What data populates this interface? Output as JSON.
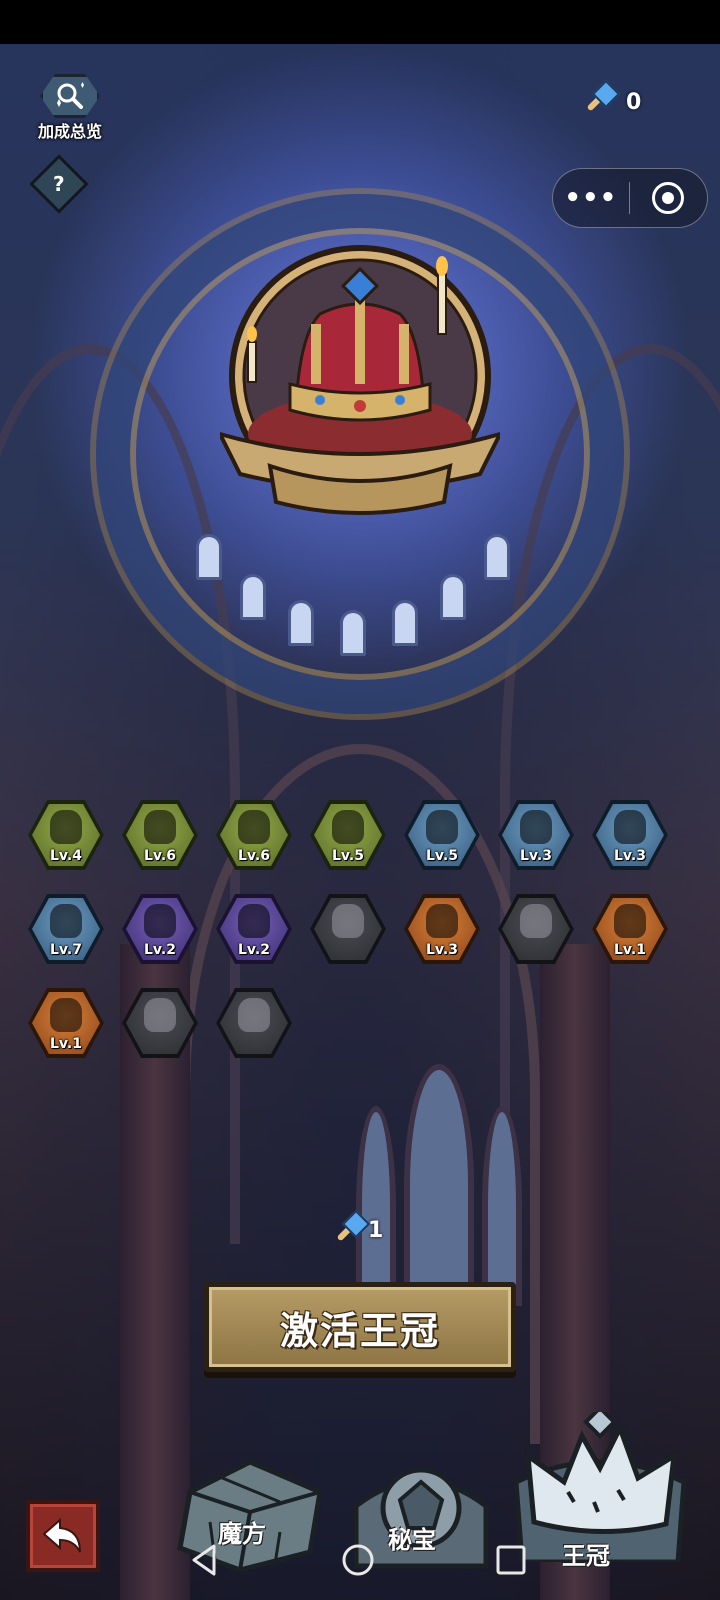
{
  "header": {
    "bonus_overview_label": "加成总览",
    "help_label": "?",
    "currency_value": "0",
    "capsule_more": "•••"
  },
  "relics": [
    {
      "id": "relic-1",
      "tier": "green",
      "level": "Lv.4"
    },
    {
      "id": "relic-2",
      "tier": "green",
      "level": "Lv.6"
    },
    {
      "id": "relic-3",
      "tier": "green",
      "level": "Lv.6"
    },
    {
      "id": "relic-4",
      "tier": "green",
      "level": "Lv.5"
    },
    {
      "id": "relic-5",
      "tier": "blue",
      "level": "Lv.5"
    },
    {
      "id": "relic-6",
      "tier": "blue",
      "level": "Lv.3"
    },
    {
      "id": "relic-7",
      "tier": "blue",
      "level": "Lv.3"
    },
    {
      "id": "relic-8",
      "tier": "blue",
      "level": "Lv.7"
    },
    {
      "id": "relic-9",
      "tier": "purple",
      "level": "Lv.2"
    },
    {
      "id": "relic-10",
      "tier": "purple",
      "level": "Lv.2"
    },
    {
      "id": "relic-11",
      "tier": "gray",
      "level": ""
    },
    {
      "id": "relic-12",
      "tier": "orange",
      "level": "Lv.3"
    },
    {
      "id": "relic-13",
      "tier": "gray",
      "level": ""
    },
    {
      "id": "relic-14",
      "tier": "orange",
      "level": "Lv.1"
    },
    {
      "id": "relic-15",
      "tier": "orange",
      "level": "Lv.1"
    },
    {
      "id": "relic-16",
      "tier": "gray",
      "level": ""
    },
    {
      "id": "relic-17",
      "tier": "gray",
      "level": ""
    }
  ],
  "activation": {
    "cost_value": "1",
    "button_label": "激活王冠"
  },
  "bottom_nav": {
    "tabs": [
      {
        "label": "魔方"
      },
      {
        "label": "秘宝"
      },
      {
        "label": "王冠"
      }
    ]
  },
  "colors": {
    "activate_button": "#a58a55",
    "back_button": "#8a2a24",
    "dome_glow": "#7888ff"
  }
}
